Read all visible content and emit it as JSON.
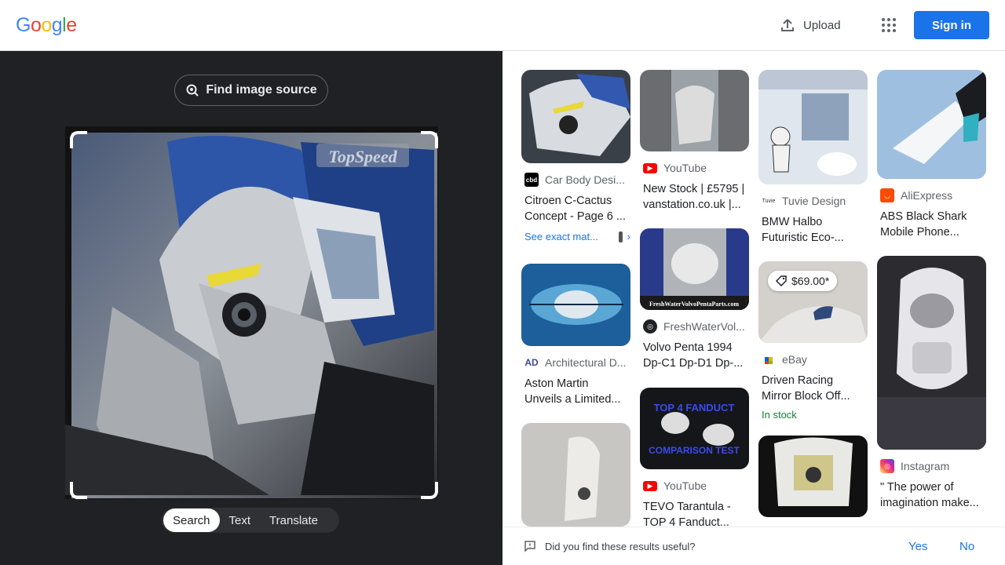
{
  "header": {
    "logo_letters": [
      "G",
      "o",
      "o",
      "g",
      "l",
      "e"
    ],
    "upload_label": "Upload",
    "signin_label": "Sign in"
  },
  "lens": {
    "find_source_label": "Find image source",
    "image_watermark": "TopSpeed",
    "modes": [
      "Search",
      "Text",
      "Translate"
    ],
    "active_mode": "Search"
  },
  "results": [
    {
      "source": "Car Body Desi...",
      "favicon": "cbd",
      "favicon_color": "#000000",
      "title": [
        "Citroen C-Cactus",
        "Concept - Page 6 ..."
      ],
      "exact": "See exact mat..."
    },
    {
      "source": "Architectural D...",
      "favicon": "AD",
      "favicon_color": "#3b4a9a",
      "title": [
        "Aston Martin",
        "Unveils a Limited..."
      ]
    },
    {
      "source": "YouTube",
      "favicon": "yt",
      "favicon_color": "#ff0000",
      "title": [
        "New Stock | £5795 |",
        "vanstation.co.uk |..."
      ]
    },
    {
      "source": "FreshWaterVol...",
      "favicon": "fw",
      "favicon_color": "#202124",
      "title": [
        "Volvo Penta 1994",
        "Dp-C1 Dp-D1 Dp-..."
      ],
      "thumb_caption": "FreshWaterVolvoPentaParts.com"
    },
    {
      "source": "YouTube",
      "favicon": "yt",
      "favicon_color": "#ff0000",
      "title": [
        "TEVO Tarantula -",
        "TOP 4 Fanduct..."
      ],
      "thumb_text_1": "TOP 4 FANDUCT",
      "thumb_text_2": "COMPARISON TEST"
    },
    {
      "source": "Tuvie Design",
      "favicon": "Tuvie",
      "favicon_color": "#ffffff",
      "title": [
        "BMW Halbo",
        "Futuristic Eco-..."
      ]
    },
    {
      "source": "eBay",
      "favicon": "eb",
      "favicon_color": "#ffffff",
      "title": [
        "Driven Racing",
        "Mirror Block Off..."
      ],
      "price": "$69.00*",
      "stock": "In stock"
    },
    {
      "source": "AliExpress",
      "favicon": "ae",
      "favicon_color": "#ff4a00",
      "title": [
        "ABS Black Shark",
        "Mobile Phone..."
      ]
    },
    {
      "source": "Instagram",
      "favicon": "ig",
      "favicon_color": "#d6249f",
      "title": [
        "\" The power of",
        "imagination make..."
      ]
    }
  ],
  "feedback": {
    "question": "Did you find these results useful?",
    "yes": "Yes",
    "no": "No"
  }
}
